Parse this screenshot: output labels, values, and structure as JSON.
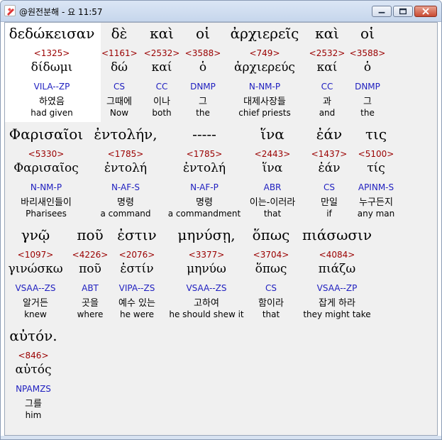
{
  "window": {
    "title": "@원전분해 - 요 11:57"
  },
  "words": [
    {
      "greek": "δεδώκεισαν",
      "strong": "<1325>",
      "lemma": "δίδωμι",
      "parse": "VILA--ZP",
      "korean": "하였음",
      "english": "had given"
    },
    {
      "greek": "δὲ",
      "strong": "<1161>",
      "lemma": "δώ",
      "parse": "CS",
      "korean": "그때에",
      "english": "Now"
    },
    {
      "greek": "καὶ",
      "strong": "<2532>",
      "lemma": "καί",
      "parse": "CC",
      "korean": "이나",
      "english": "both"
    },
    {
      "greek": "οἱ",
      "strong": "<3588>",
      "lemma": "ὁ",
      "parse": "DNMP",
      "korean": "그",
      "english": "the"
    },
    {
      "greek": "ἀρχιερεῖς",
      "strong": "<749>",
      "lemma": "ἀρχιερεύς",
      "parse": "N-NM-P",
      "korean": "대제사장들",
      "english": "chief priests"
    },
    {
      "greek": "καὶ",
      "strong": "<2532>",
      "lemma": "καί",
      "parse": "CC",
      "korean": "과",
      "english": "and"
    },
    {
      "greek": "οἱ",
      "strong": "<3588>",
      "lemma": "ὁ",
      "parse": "DNMP",
      "korean": "그",
      "english": "the"
    },
    {
      "greek": "Φαρισαῖοι",
      "strong": "<5330>",
      "lemma": "Φαρισαῖος",
      "parse": "N-NM-P",
      "korean": "바리새인들이",
      "english": "Pharisees"
    },
    {
      "greek": "ἐντολήν,",
      "strong": "<1785>",
      "lemma": "ἐντολή",
      "parse": "N-AF-S",
      "korean": "명령",
      "english": "a command"
    },
    {
      "greek": "-----",
      "strong": "<1785>",
      "lemma": "ἐντολή",
      "parse": "N-AF-P",
      "korean": "명령",
      "english": "a commandment"
    },
    {
      "greek": "ἵνα",
      "strong": "<2443>",
      "lemma": "ἵνα",
      "parse": "ABR",
      "korean": "이는-이러라",
      "english": "that"
    },
    {
      "greek": "ἐάν",
      "strong": "<1437>",
      "lemma": "ἐάν",
      "parse": "CS",
      "korean": "만일",
      "english": "if"
    },
    {
      "greek": "τις",
      "strong": "<5100>",
      "lemma": "τίς",
      "parse": "APINM-S",
      "korean": "누구든지",
      "english": "any man"
    },
    {
      "greek": "γνῷ",
      "strong": "<1097>",
      "lemma": "γινώσκω",
      "parse": "VSAA--ZS",
      "korean": "알거든",
      "english": "knew"
    },
    {
      "greek": "ποῦ",
      "strong": "<4226>",
      "lemma": "ποῦ",
      "parse": "ABT",
      "korean": "곳을",
      "english": "where"
    },
    {
      "greek": "ἐστιν",
      "strong": "<2076>",
      "lemma": "ἐστίν",
      "parse": "VIPA--ZS",
      "korean": "예수 있는",
      "english": "he were"
    },
    {
      "greek": "μηνύσῃ,",
      "strong": "<3377>",
      "lemma": "μηνύω",
      "parse": "VSAA--ZS",
      "korean": "고하여",
      "english": "he should shew it"
    },
    {
      "greek": "ὅπως",
      "strong": "<3704>",
      "lemma": "ὅπως",
      "parse": "CS",
      "korean": "함이라",
      "english": "that"
    },
    {
      "greek": "πιάσωσιν",
      "strong": "<4084>",
      "lemma": "πιάζω",
      "parse": "VSAA--ZP",
      "korean": "잡게 하라",
      "english": "they might take"
    },
    {
      "greek": "αὐτόν.",
      "strong": "<846>",
      "lemma": "αὐτός",
      "parse": "NPAMZS",
      "korean": "그를",
      "english": "him"
    }
  ],
  "icons": {
    "app": "app-logo-icon",
    "minimize": "minimize-icon",
    "maximize": "maximize-icon",
    "close": "close-icon"
  },
  "colors": {
    "strong_number": "#9a0000",
    "parse_code": "#2020c0",
    "selected_background": "#ffffff",
    "content_background": "#f0f0f0"
  }
}
